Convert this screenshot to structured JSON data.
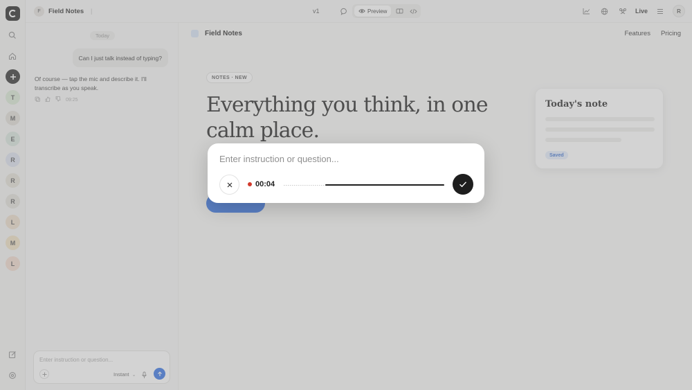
{
  "topbar": {
    "project_initial": "F",
    "project_name": "Field Notes",
    "version": "v1",
    "preview_label": "Preview",
    "live_label": "Live",
    "user_initial": "R",
    "icons": [
      "chart-icon",
      "globe-icon",
      "users-icon",
      "menu-icon",
      "comment-icon",
      "device-icon",
      "code-icon"
    ]
  },
  "rail": {
    "avatars": [
      {
        "initial": "T",
        "color": "#d9e8d4"
      },
      {
        "initial": "M",
        "color": "#e0ddd6"
      },
      {
        "initial": "E",
        "color": "#d7e6dc"
      },
      {
        "initial": "R",
        "color": "#dbe1ee"
      },
      {
        "initial": "R",
        "color": "#e4e1d6"
      },
      {
        "initial": "R",
        "color": "#e2e0da"
      },
      {
        "initial": "L",
        "color": "#ecdcca"
      },
      {
        "initial": "M",
        "color": "#efe0c2"
      },
      {
        "initial": "L",
        "color": "#f2d9cc"
      }
    ]
  },
  "chat": {
    "day_label": "Today",
    "user_message": "Can I just talk instead of typing?",
    "assistant_message": "Of course — tap the mic and describe it. I'll transcribe as you speak.",
    "message_time": "09:25",
    "composer": {
      "placeholder": "Enter instruction or question...",
      "mode_label": "Instant"
    }
  },
  "site": {
    "brand": "Field Notes",
    "nav_links": [
      "Features",
      "Pricing"
    ],
    "badge": "NOTES · NEW",
    "hero_title": "Everything you think, in one calm place.",
    "note_card": {
      "title": "Today's note",
      "status": "Saved"
    }
  },
  "voice_dialog": {
    "placeholder": "Enter instruction or question...",
    "timer": "00:04",
    "recording_color": "#d23a2c",
    "level": 0.74
  },
  "colors": {
    "accent": "#2f6fe4",
    "dark": "#1e1e1e"
  }
}
